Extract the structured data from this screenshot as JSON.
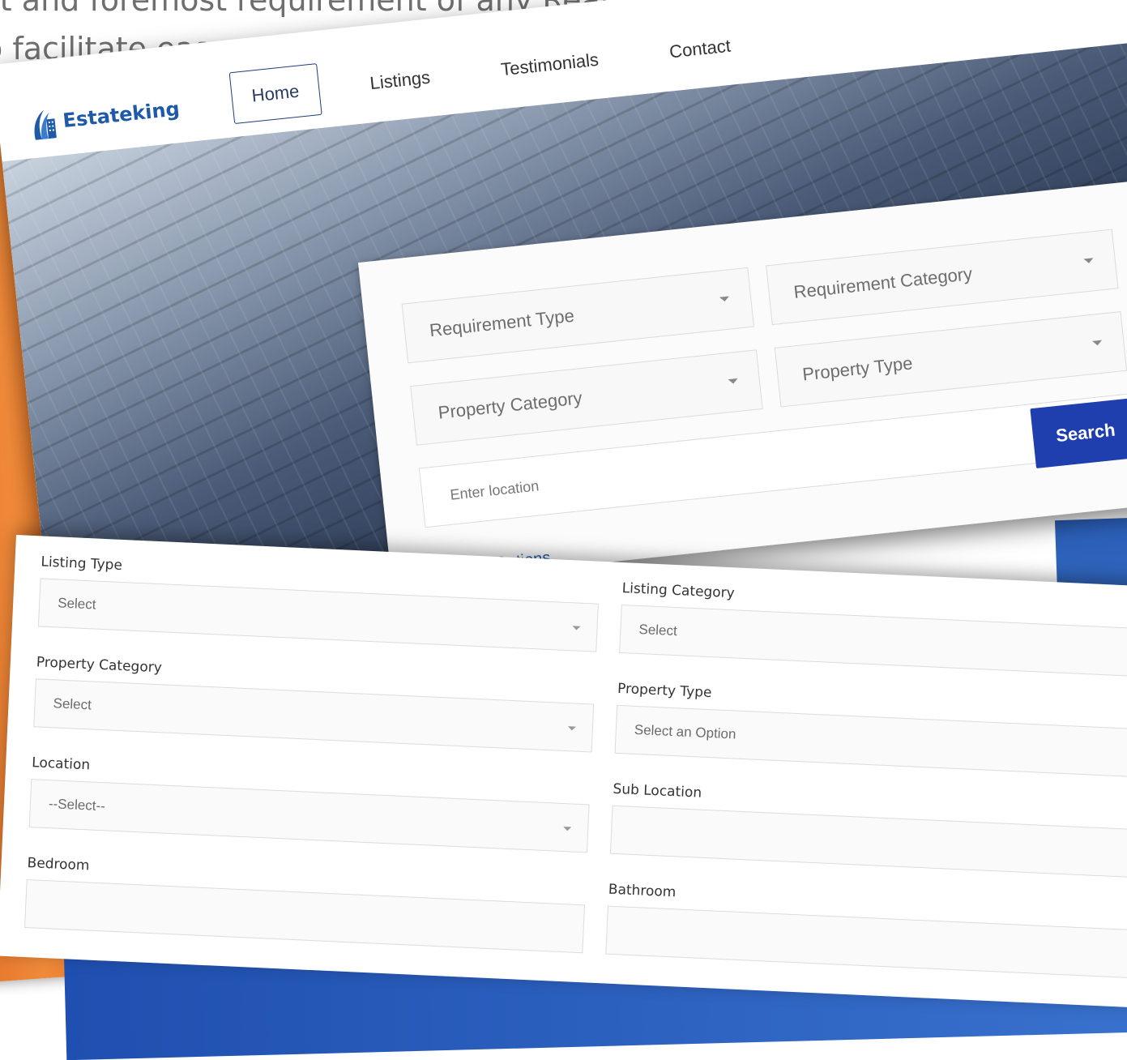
{
  "intro": {
    "line1": "st and foremost requirement of any Real Estate Agency.",
    "line2": "o facilitate easy maintenance."
  },
  "site": {
    "logo_text": "Estateking",
    "nav": [
      "Home",
      "Listings",
      "Testimonials",
      "Contact"
    ],
    "search": {
      "requirement_type": "Requirement Type",
      "requirement_category": "Requirement Category",
      "property_category": "Property Category",
      "property_type": "Property Type",
      "location_placeholder": "Enter location",
      "search_label": "Search",
      "more_options": "More Options"
    }
  },
  "form": {
    "listing_type": {
      "label": "Listing Type",
      "value": "Select"
    },
    "listing_category": {
      "label": "Listing Category",
      "value": "Select"
    },
    "property_category": {
      "label": "Property Category",
      "value": "Select"
    },
    "property_type": {
      "label": "Property Type",
      "value": "Select an Option"
    },
    "location": {
      "label": "Location",
      "value": "--Select--"
    },
    "sub_location": {
      "label": "Sub Location",
      "value": ""
    },
    "bedroom": {
      "label": "Bedroom",
      "value": ""
    },
    "bathroom": {
      "label": "Bathroom",
      "value": ""
    }
  },
  "colors": {
    "accent": "#1f3fae",
    "orange": "#e2701f",
    "logo": "#1f5aa8"
  }
}
